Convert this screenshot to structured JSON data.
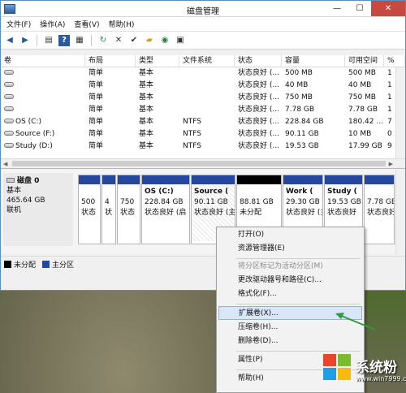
{
  "window": {
    "title": "磁盘管理",
    "minimize_glyph": "—",
    "maximize_glyph": "☐",
    "close_glyph": "✕"
  },
  "menubar": {
    "items": [
      "文件(F)",
      "操作(A)",
      "查看(V)",
      "帮助(H)"
    ]
  },
  "toolbar": {
    "icons": [
      "back-icon",
      "forward-icon",
      "console-tree-icon",
      "help-icon",
      "properties-icon",
      "refresh-icon",
      "delete-icon",
      "checkmark-icon",
      "open-folder-icon",
      "search-disk-icon",
      "view-icon"
    ]
  },
  "volume_table": {
    "columns": [
      "卷",
      "布局",
      "类型",
      "文件系统",
      "状态",
      "容量",
      "可用空间",
      "%"
    ],
    "rows": [
      {
        "volume": "",
        "layout": "简单",
        "type": "基本",
        "fs": "",
        "status": "状态良好 (...",
        "capacity": "500 MB",
        "free": "500 MB",
        "pct": "1"
      },
      {
        "volume": "",
        "layout": "简单",
        "type": "基本",
        "fs": "",
        "status": "状态良好 (...",
        "capacity": "40 MB",
        "free": "40 MB",
        "pct": "1"
      },
      {
        "volume": "",
        "layout": "简单",
        "type": "基本",
        "fs": "",
        "status": "状态良好 (...",
        "capacity": "750 MB",
        "free": "750 MB",
        "pct": "1"
      },
      {
        "volume": "",
        "layout": "简单",
        "type": "基本",
        "fs": "",
        "status": "状态良好 (...",
        "capacity": "7.78 GB",
        "free": "7.78 GB",
        "pct": "1"
      },
      {
        "volume": "OS (C:)",
        "layout": "简单",
        "type": "基本",
        "fs": "NTFS",
        "status": "状态良好 (...",
        "capacity": "228.84 GB",
        "free": "180.42 ...",
        "pct": "7"
      },
      {
        "volume": "Source (F:)",
        "layout": "简单",
        "type": "基本",
        "fs": "NTFS",
        "status": "状态良好 (...",
        "capacity": "90.11 GB",
        "free": "10 MB",
        "pct": "0"
      },
      {
        "volume": "Study (D:)",
        "layout": "简单",
        "type": "基本",
        "fs": "NTFS",
        "status": "状态良好 (...",
        "capacity": "19.53 GB",
        "free": "17.99 GB",
        "pct": "9"
      }
    ]
  },
  "disk0": {
    "name": "磁盘 0",
    "type": "基本",
    "size": "465.64 GB",
    "status": "联机",
    "partitions": [
      {
        "line1": "",
        "line2": "500",
        "line3": "状态"
      },
      {
        "line1": "",
        "line2": "4",
        "line3": "状"
      },
      {
        "line1": "",
        "line2": "750",
        "line3": "状态"
      },
      {
        "line1": "OS  (C:)",
        "line2": "228.84 GB",
        "line3": "状态良好 (启"
      },
      {
        "line1": "Source (",
        "line2": "90.11 GB",
        "line3": "状态良好 (主"
      },
      {
        "line1": "",
        "line2": "88.81 GB",
        "line3": "未分配"
      },
      {
        "line1": "Work  (",
        "line2": "29.30 GB",
        "line3": "状态良好 (主"
      },
      {
        "line1": "Study (",
        "line2": "19.53 GB",
        "line3": "状态良好"
      },
      {
        "line1": "",
        "line2": "7.78 GB",
        "line3": "状态良好"
      }
    ]
  },
  "legend": {
    "items": [
      {
        "label": "未分配",
        "color": "#000000"
      },
      {
        "label": "主分区",
        "color": "#25489c"
      }
    ]
  },
  "context_menu": {
    "items": [
      {
        "label": "打开(O)",
        "enabled": true
      },
      {
        "label": "资源管理器(E)",
        "enabled": true
      },
      {
        "label": "将分区标记为活动分区(M)",
        "enabled": false
      },
      {
        "label": "更改驱动器号和路径(C)...",
        "enabled": true
      },
      {
        "label": "格式化(F)...",
        "enabled": true
      },
      {
        "label": "扩展卷(X)...",
        "enabled": true,
        "highlighted": true
      },
      {
        "label": "压缩卷(H)...",
        "enabled": true
      },
      {
        "label": "删除卷(D)...",
        "enabled": true
      },
      {
        "label": "属性(P)",
        "enabled": true
      },
      {
        "label": "帮助(H)",
        "enabled": true
      }
    ]
  },
  "watermark": {
    "text": "系统粉",
    "url": "www.win7999.com"
  },
  "colors": {
    "primary_partition": "#25489c",
    "unallocated": "#000000",
    "highlight": "#d8e6f7",
    "arrow": "#2e9c3a"
  }
}
